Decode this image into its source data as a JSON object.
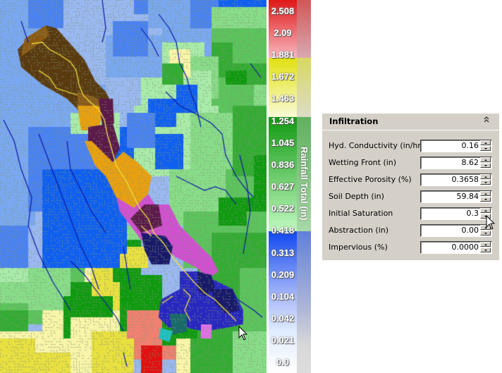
{
  "map": {
    "label": "Rainfall watershed map",
    "colors": {
      "brown_dark": "#5a3b10",
      "brown": "#8b5a14",
      "orange": "#e8a010",
      "purple_dark": "#5c1a4a",
      "magenta": "#d050d0",
      "magenta_light": "#e070e8",
      "navy": "#1a1a6a",
      "indigo": "#2828c0",
      "blue_bright": "#1060f0",
      "blue_mid": "#4a82f0",
      "blue_light": "#7aa8f0",
      "lavender": "#9ab8f0",
      "green_pale": "#a8eaa8",
      "green_light": "#88dc88",
      "green_mid": "#5cc45c",
      "green": "#34ac34",
      "green_dark": "#109a10",
      "yellow_pale": "#f8f4a8",
      "yellow": "#e8e040",
      "salmon": "#f08070",
      "red": "#e01010",
      "teal": "#1a6a6a",
      "cyan": "#20c0c0",
      "stream_blue": "#0a1aa8",
      "stream_yellow": "#f0e040",
      "drainage": "#8a9a7a"
    }
  },
  "legend": {
    "title": "Rainfall Total (in)",
    "ticks": [
      "2.508",
      "2.09",
      "1.881",
      "1.672",
      "1.463",
      "1.254",
      "1.045",
      "0.836",
      "0.627",
      "0.522",
      "0.418",
      "0.313",
      "0.209",
      "0.104",
      "0.042",
      "0.021",
      "0.0"
    ],
    "bands": [
      {
        "from": "2.508",
        "to": "1.881",
        "top_color": "#e01818",
        "bottom_color": "#f8b8c0"
      },
      {
        "from": "1.881",
        "to": "1.254",
        "top_color": "#e0e010",
        "bottom_color": "#fafad8"
      },
      {
        "from": "1.254",
        "to": "0.418",
        "top_color": "#109a10",
        "bottom_color": "#c0f8c0"
      },
      {
        "from": "0.418",
        "to": "0.0",
        "top_color": "#1048f0",
        "bottom_color": "#ffffff"
      }
    ]
  },
  "panel": {
    "title": "Infiltration",
    "collapse_icon": "double-chevron-up-icon",
    "fields": [
      {
        "label": "Hyd. Conductivity (in/hr)",
        "value": "0.16"
      },
      {
        "label": "Wetting Front (in)",
        "value": "8.62"
      },
      {
        "label": "Effective Porosity (%)",
        "value": "0.3658"
      },
      {
        "label": "Soil Depth (in)",
        "value": "59.84"
      },
      {
        "label": "Initial Saturation",
        "value": "0.3"
      },
      {
        "label": "Abstraction (in)",
        "value": "0.00"
      },
      {
        "label": "Impervious (%)",
        "value": "0.0000"
      }
    ]
  }
}
